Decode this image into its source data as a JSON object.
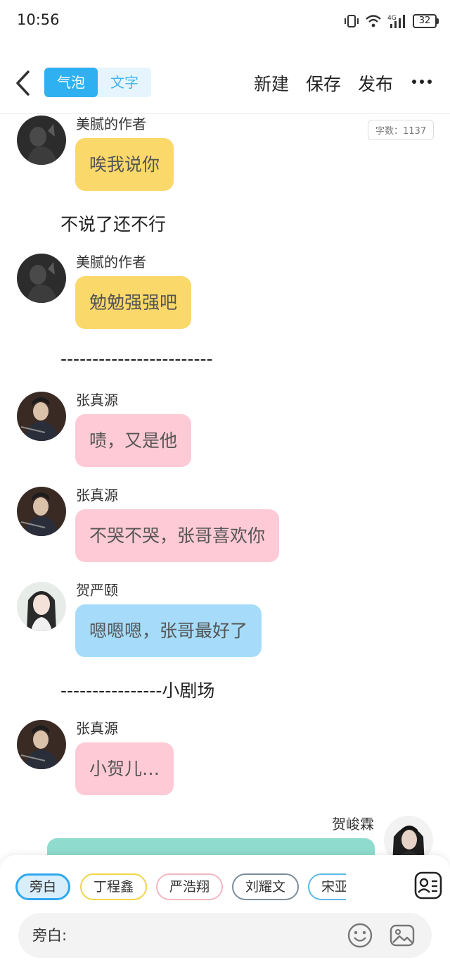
{
  "status_bar": {
    "time": "10:56",
    "network": "4G",
    "battery": "32",
    "icons": [
      "vibrate-icon",
      "wifi-icon",
      "signal-icon",
      "battery-icon"
    ]
  },
  "toolbar": {
    "tabs": [
      {
        "label": "气泡",
        "active": true
      },
      {
        "label": "文字",
        "active": false
      }
    ],
    "new_label": "新建",
    "save_label": "保存",
    "publish_label": "发布",
    "icons": [
      "back-icon",
      "more-icon"
    ]
  },
  "word_count": "字数：1137",
  "messages": [
    {
      "kind": "bubble",
      "sender": "美腻的作者",
      "text": "唉我说你",
      "color": "#fbd86a"
    },
    {
      "kind": "narration",
      "text": "不说了还不行"
    },
    {
      "kind": "bubble",
      "sender": "美腻的作者",
      "text": "勉勉强强吧",
      "color": "#fbd86a"
    },
    {
      "kind": "narration",
      "text": "------------------------"
    },
    {
      "kind": "bubble",
      "sender": "张真源",
      "text": "啧，又是他",
      "color": "#fecad6"
    },
    {
      "kind": "bubble",
      "sender": "张真源",
      "text": "不哭不哭，张哥喜欢你",
      "color": "#fecad6"
    },
    {
      "kind": "bubble",
      "sender": "贺严颐",
      "text": "嗯嗯嗯，张哥最好了",
      "color": "#a6dcf9"
    },
    {
      "kind": "narration",
      "text": "----------------小剧场"
    },
    {
      "kind": "bubble",
      "sender": "张真源",
      "text": "小贺儿…",
      "color": "#fecad6"
    },
    {
      "kind": "bubble",
      "sender": "贺峻霖",
      "text": "",
      "color": "#8fdccf",
      "side": "right"
    }
  ],
  "characters": [
    {
      "name": "旁白",
      "border": "#2fa8ee",
      "selected": true
    },
    {
      "name": "丁程鑫",
      "border": "#f0d54a",
      "selected": false
    },
    {
      "name": "严浩翔",
      "border": "#f2b8c0",
      "selected": false
    },
    {
      "name": "刘耀文",
      "border": "#7d8c9a",
      "selected": false
    },
    {
      "name": "宋亚轩",
      "border": "#5fb8e8",
      "selected": false
    }
  ],
  "input": {
    "label": "旁白:",
    "value": "",
    "icons": [
      "emoji-icon",
      "image-icon"
    ]
  },
  "colors": {
    "accent": "#2fb0f0",
    "yellow_bubble": "#fbd86a",
    "pink_bubble": "#fecad6",
    "blue_bubble": "#a6dcf9",
    "teal_bubble": "#8fdccf"
  }
}
